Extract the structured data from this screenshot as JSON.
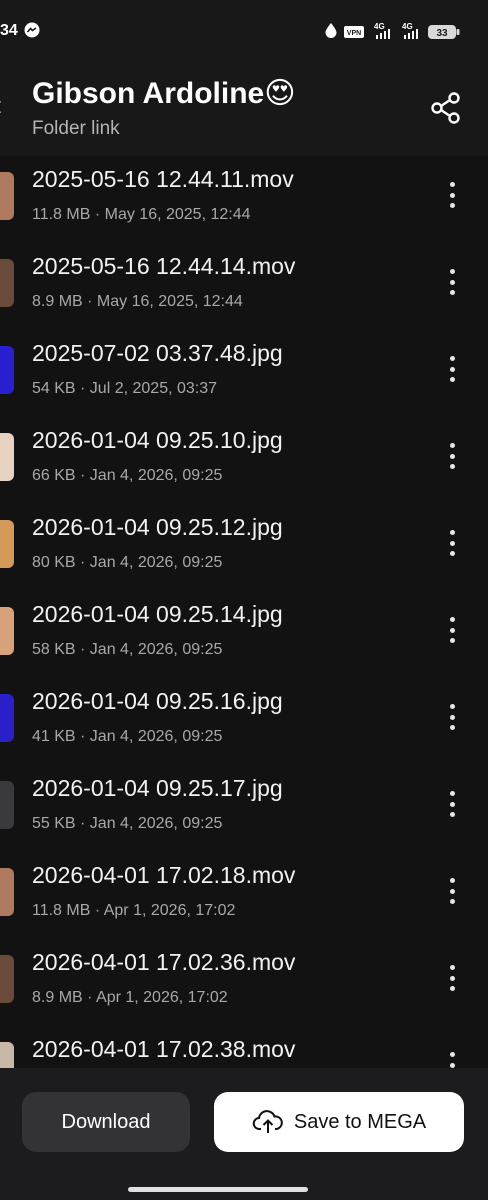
{
  "status_bar": {
    "time": "34",
    "vpn_label": "VPN",
    "network_1": "4G",
    "network_2": "4G",
    "battery": "33"
  },
  "header": {
    "title": "Gibson Ardoline😍",
    "subtitle": "Folder link",
    "share_icon": "share-icon"
  },
  "files": [
    {
      "name": "2025-05-16 12.44.11.mov",
      "meta": "11.8 MB · May 16, 2025, 12:44",
      "thumb_color": "#b07a60"
    },
    {
      "name": "2025-05-16 12.44.14.mov",
      "meta": "8.9 MB · May 16, 2025, 12:44",
      "thumb_color": "#6a4a3a"
    },
    {
      "name": "2025-07-02 03.37.48.jpg",
      "meta": "54 KB · Jul 2, 2025, 03:37",
      "thumb_color": "#2a1fd0"
    },
    {
      "name": "2026-01-04 09.25.10.jpg",
      "meta": "66 KB · Jan 4, 2026, 09:25",
      "thumb_color": "#e8d2c2"
    },
    {
      "name": "2026-01-04 09.25.12.jpg",
      "meta": "80 KB · Jan 4, 2026, 09:25",
      "thumb_color": "#d49a5a"
    },
    {
      "name": "2026-01-04 09.25.14.jpg",
      "meta": "58 KB · Jan 4, 2026, 09:25",
      "thumb_color": "#d8a27a"
    },
    {
      "name": "2026-01-04 09.25.16.jpg",
      "meta": "41 KB · Jan 4, 2026, 09:25",
      "thumb_color": "#2a1fc8"
    },
    {
      "name": "2026-01-04 09.25.17.jpg",
      "meta": "55 KB · Jan 4, 2026, 09:25",
      "thumb_color": "#3a3a3e"
    },
    {
      "name": "2026-04-01 17.02.18.mov",
      "meta": "11.8 MB · Apr 1, 2026, 17:02",
      "thumb_color": "#b07a60"
    },
    {
      "name": "2026-04-01 17.02.36.mov",
      "meta": "8.9 MB · Apr 1, 2026, 17:02",
      "thumb_color": "#6a4a3a"
    },
    {
      "name": "2026-04-01 17.02.38.mov",
      "meta": "",
      "thumb_color": "#c8b8a8"
    }
  ],
  "bottom_bar": {
    "download_label": "Download",
    "save_label": "Save to MEGA",
    "save_icon": "cloud-upload-icon"
  }
}
